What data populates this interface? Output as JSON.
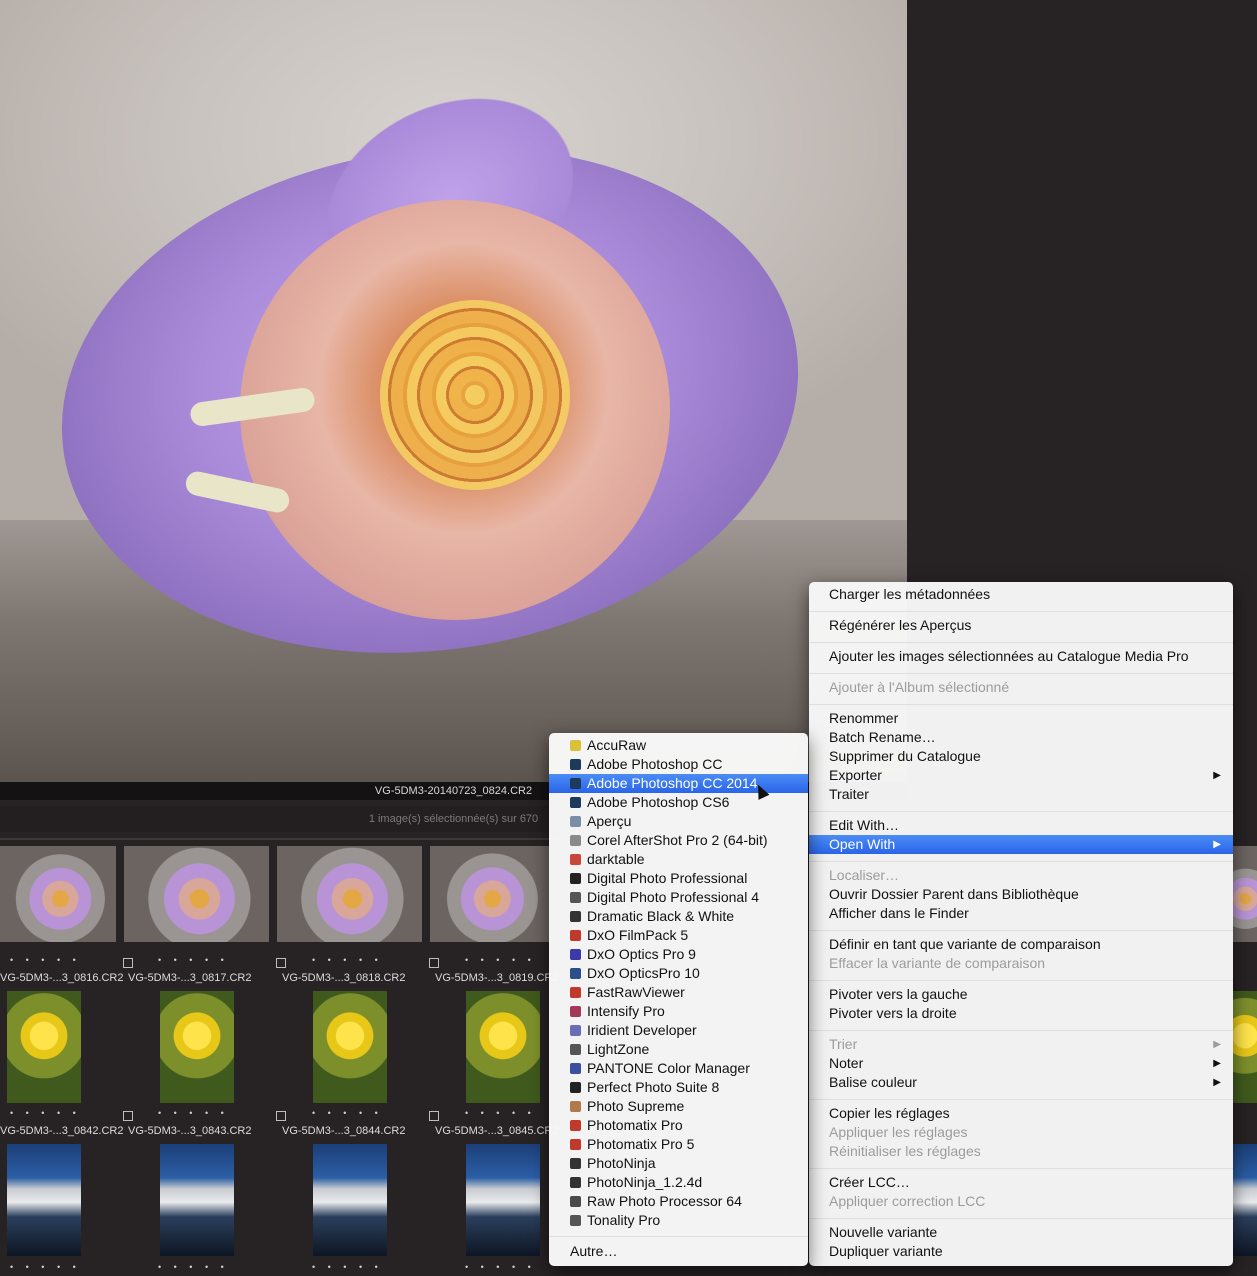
{
  "preview": {
    "filename": "VG-5DM3-20140723_0824.CR2",
    "selection_count": "1 image(s) sélectionnée(s) sur 670"
  },
  "thumbnails": {
    "row1": [
      "VG-5DM3-...3_0816.CR2",
      "VG-5DM3-...3_0817.CR2",
      "VG-5DM3-...3_0818.CR2",
      "VG-5DM3-...3_0819.CR2"
    ],
    "row2": [
      "VG-5DM3-...3_0842.CR2",
      "VG-5DM3-...3_0843.CR2",
      "VG-5DM3-...3_0844.CR2",
      "VG-5DM3-...3_0845.CR2"
    ],
    "dots": "• • • • •"
  },
  "context_menu": {
    "items": [
      {
        "label": "Charger les métadonnées",
        "disabled": false
      },
      {
        "label": "Régénérer les Aperçus",
        "disabled": false
      },
      {
        "label": "Ajouter les images sélectionnées au Catalogue Media Pro",
        "disabled": false
      },
      {
        "label": "Ajouter à l'Album sélectionné",
        "disabled": true
      },
      {
        "label": "Renommer",
        "disabled": false
      },
      {
        "label": "Batch Rename…",
        "disabled": false
      },
      {
        "label": "Supprimer du Catalogue",
        "disabled": false
      },
      {
        "label": "Exporter",
        "disabled": false,
        "submenu": true
      },
      {
        "label": "Traiter",
        "disabled": false
      },
      {
        "label": "Edit With…",
        "disabled": false
      },
      {
        "label": "Open With",
        "disabled": false,
        "submenu": true,
        "highlighted": true
      },
      {
        "label": "Localiser…",
        "disabled": true
      },
      {
        "label": "Ouvrir Dossier Parent dans Bibliothèque",
        "disabled": false
      },
      {
        "label": "Afficher dans le Finder",
        "disabled": false
      },
      {
        "label": "Définir en tant que variante de comparaison",
        "disabled": false
      },
      {
        "label": "Effacer la variante de comparaison",
        "disabled": true
      },
      {
        "label": "Pivoter vers la gauche",
        "disabled": false
      },
      {
        "label": "Pivoter vers la droite",
        "disabled": false
      },
      {
        "label": "Trier",
        "disabled": true,
        "submenu": true
      },
      {
        "label": "Noter",
        "disabled": false,
        "submenu": true
      },
      {
        "label": "Balise couleur",
        "disabled": false,
        "submenu": true
      },
      {
        "label": "Copier les réglages",
        "disabled": false
      },
      {
        "label": "Appliquer les réglages",
        "disabled": true
      },
      {
        "label": "Réinitialiser les réglages",
        "disabled": true
      },
      {
        "label": "Créer LCC…",
        "disabled": false
      },
      {
        "label": "Appliquer correction LCC",
        "disabled": true
      },
      {
        "label": "Nouvelle variante",
        "disabled": false
      },
      {
        "label": "Dupliquer variante",
        "disabled": false
      }
    ],
    "submenu_arrow": "▶"
  },
  "open_with_submenu": {
    "apps": [
      {
        "label": "AccuRaw",
        "icon": "accuraw-icon",
        "color": "#d9c23a"
      },
      {
        "label": "Adobe Photoshop CC",
        "icon": "photoshop-icon",
        "color": "#1b3a5c"
      },
      {
        "label": "Adobe Photoshop CC 2014",
        "icon": "photoshop-icon",
        "color": "#1b3a5c",
        "highlighted": true
      },
      {
        "label": "Adobe Photoshop CS6",
        "icon": "photoshop-icon",
        "color": "#1b3a5c"
      },
      {
        "label": "Aperçu",
        "icon": "preview-icon",
        "color": "#7a8fa6"
      },
      {
        "label": "Corel AfterShot Pro 2 (64-bit)",
        "icon": "aftershot-icon",
        "color": "#8a8a8a"
      },
      {
        "label": "darktable",
        "icon": "darktable-icon",
        "color": "#c8463a"
      },
      {
        "label": "Digital Photo Professional",
        "icon": "dpp-icon",
        "color": "#222222"
      },
      {
        "label": "Digital Photo Professional 4",
        "icon": "dpp-icon",
        "color": "#555555"
      },
      {
        "label": "Dramatic Black & White",
        "icon": "dramatic-bw-icon",
        "color": "#333333"
      },
      {
        "label": "DxO FilmPack 5",
        "icon": "filmpack-icon",
        "color": "#c0392b"
      },
      {
        "label": "DxO Optics Pro 9",
        "icon": "dxo-icon",
        "color": "#3a3aa8"
      },
      {
        "label": "DxO OpticsPro 10",
        "icon": "dxo-icon",
        "color": "#2a4f8a"
      },
      {
        "label": "FastRawViewer",
        "icon": "fastrawviewer-icon",
        "color": "#c0392b"
      },
      {
        "label": "Intensify Pro",
        "icon": "intensify-icon",
        "color": "#a33a55"
      },
      {
        "label": "Iridient Developer",
        "icon": "iridient-icon",
        "color": "#6a6fb5"
      },
      {
        "label": "LightZone",
        "icon": "lightzone-icon",
        "color": "#555555"
      },
      {
        "label": "PANTONE Color Manager",
        "icon": "pantone-icon",
        "color": "#3a4fa0"
      },
      {
        "label": "Perfect Photo Suite 8",
        "icon": "perfect-photo-icon",
        "color": "#222222"
      },
      {
        "label": "Photo Supreme",
        "icon": "photo-supreme-icon",
        "color": "#b07a4a"
      },
      {
        "label": "Photomatix Pro",
        "icon": "photomatix-icon",
        "color": "#c0392b"
      },
      {
        "label": "Photomatix Pro 5",
        "icon": "photomatix-icon",
        "color": "#c0392b"
      },
      {
        "label": "PhotoNinja",
        "icon": "photoninja-icon",
        "color": "#333333"
      },
      {
        "label": "PhotoNinja_1.2.4d",
        "icon": "photoninja-icon",
        "color": "#333333"
      },
      {
        "label": "Raw Photo Processor 64",
        "icon": "rpp-icon",
        "color": "#4a4a4a"
      },
      {
        "label": "Tonality Pro",
        "icon": "tonality-icon",
        "color": "#555555"
      }
    ],
    "other": "Autre…"
  }
}
